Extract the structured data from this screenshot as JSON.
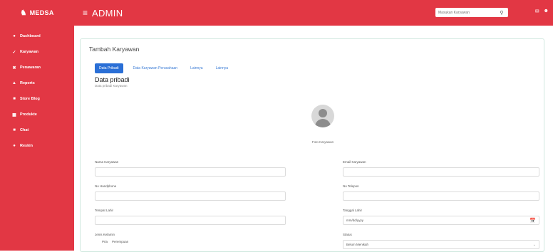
{
  "brand": {
    "logo_icon": "user-group-icon",
    "name": "MEDSA"
  },
  "topbar": {
    "title": "ADMIN",
    "search_placeholder": "Masukan Karyawan",
    "search_icon": "search-icon",
    "icons": [
      "mail-icon",
      "user-icon"
    ]
  },
  "sidebar": {
    "items": [
      {
        "label": "Dashboard",
        "icon": "dashboard-icon"
      },
      {
        "label": "Karyawan",
        "icon": "users-icon"
      },
      {
        "label": "Penawaran",
        "icon": "tag-icon"
      },
      {
        "label": "Reports",
        "icon": "report-icon"
      },
      {
        "label": "Store Blog",
        "icon": "store-icon"
      },
      {
        "label": "Produkte",
        "icon": "box-icon"
      },
      {
        "label": "Chat",
        "icon": "chat-icon"
      },
      {
        "label": "Reskin",
        "icon": "palette-icon"
      }
    ]
  },
  "page": {
    "title": "Tambah Karyawan",
    "tabs": [
      "Data Pribadi",
      "Data Karyawan Perusahaan",
      "Lainnya",
      "Lainnya"
    ],
    "section_title": "Data pribadi",
    "section_subtitle": "Data pribadi Karyawan",
    "photo_label": "Foto Karyawan"
  },
  "form": {
    "nama_label": "Nama Karyawan",
    "email_label": "Email Karyawan",
    "hp_label": "No Handphone",
    "telp_label": "No Telepon",
    "tempat_label": "Tempat Lahir",
    "tanggal_label": "Tanggal Lahir",
    "tanggal_value": "mm/dd/yyyy",
    "jk_label": "Jenis Kelamin",
    "jk_options": [
      "Pria",
      "Perempuan"
    ],
    "status_label": "Status",
    "status_value": "Belum Menikah"
  }
}
